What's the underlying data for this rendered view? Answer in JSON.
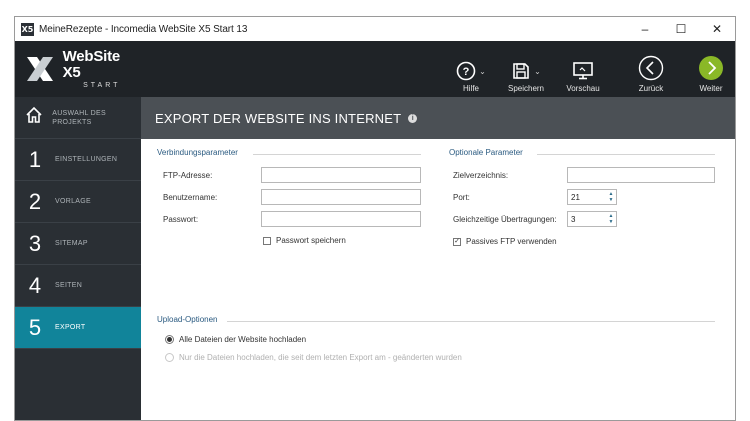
{
  "window": {
    "title": "MeineRezepte - Incomedia WebSite X5 Start 13",
    "app_icon": "X5",
    "controls": [
      "–",
      "☐",
      "✕"
    ]
  },
  "logo": {
    "name": "WebSite X5",
    "edition": "START"
  },
  "toolbar": {
    "help_label": "Hilfe",
    "save_label": "Speichern",
    "preview_label": "Vorschau",
    "back_label": "Zurück",
    "next_label": "Weiter",
    "next_color": "#8ab827"
  },
  "sidebar": {
    "items": [
      {
        "num": "⌂",
        "label": "AUSWAHL DES PROJEKTS"
      },
      {
        "num": "1",
        "label": "EINSTELLUNGEN"
      },
      {
        "num": "2",
        "label": "VORLAGE"
      },
      {
        "num": "3",
        "label": "SITEMAP"
      },
      {
        "num": "4",
        "label": "SEITEN"
      },
      {
        "num": "5",
        "label": "EXPORT",
        "active": true
      }
    ],
    "active_color": "#11849a"
  },
  "header": {
    "title": "EXPORT DER WEBSITE INS INTERNET",
    "info_icon": "i"
  },
  "connection": {
    "section_title": "Verbindungsparameter",
    "ftp_label": "FTP-Adresse:",
    "ftp_value": "",
    "user_label": "Benutzername:",
    "user_value": "",
    "password_label": "Passwort:",
    "password_value": "",
    "save_password_label": "Passwort speichern",
    "save_password_checked": false
  },
  "optional": {
    "section_title": "Optionale Parameter",
    "target_dir_label": "Zielverzeichnis:",
    "target_dir_value": "",
    "port_label": "Port:",
    "port_value": "21",
    "concurrent_label": "Gleichzeitige Übertragungen:",
    "concurrent_value": "3",
    "passive_ftp_label": "Passives FTP verwenden",
    "passive_ftp_checked": true
  },
  "upload": {
    "section_title": "Upload-Optionen",
    "option_all": "Alle Dateien der Website hochladen",
    "option_changed": "Nur die Dateien hochladen, die seit dem letzten Export am - geänderten wurden",
    "selected": "all"
  }
}
